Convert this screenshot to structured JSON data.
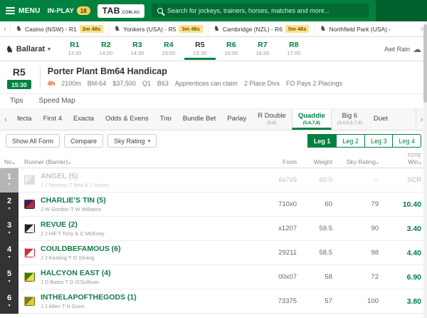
{
  "header": {
    "menu": "MENU",
    "in_play": "IN-PLAY",
    "in_play_count": "18",
    "logo_main": "TAB",
    "logo_suffix": ".COM.AU",
    "search_placeholder": "Search for jockeys, trainers, horses, matches and more...",
    "colors": {
      "bar_green": "#00813f",
      "search_green": "#006a33",
      "badge_yellow": "#ffe18a"
    }
  },
  "next_to_go": {
    "items": [
      {
        "name": "Casino (NSW) - R1",
        "countdown": "2m 48s"
      },
      {
        "name": "Yonkers (USA) - R5",
        "countdown": "3m 48s"
      },
      {
        "name": "Cambridge (NZL) - R6",
        "countdown": "5m 48s"
      },
      {
        "name": "Northfield Park (USA) -",
        "countdown": ""
      }
    ]
  },
  "race_nav": {
    "venue": "Ballarat",
    "weather": "Awt Rain",
    "races": [
      {
        "no": "R1",
        "time": "13:30",
        "selected": false
      },
      {
        "no": "R2",
        "time": "14:00",
        "selected": false
      },
      {
        "no": "R3",
        "time": "14:30",
        "selected": false
      },
      {
        "no": "R4",
        "time": "15:00",
        "selected": false
      },
      {
        "no": "R5",
        "time": "15:30",
        "selected": true
      },
      {
        "no": "R6",
        "time": "16:00",
        "selected": false
      },
      {
        "no": "R7",
        "time": "16:30",
        "selected": false
      },
      {
        "no": "R8",
        "time": "17:00",
        "selected": false
      }
    ]
  },
  "race_header": {
    "race_no": "R5",
    "time": "15:30",
    "title": "Porter Plant Bm64 Handicap",
    "countdown": "4h",
    "meta_items": [
      "2100m",
      "BM-64",
      "$37,500",
      "Q1",
      "B63",
      "Apprentices can claim",
      "2 Place Divs",
      "FO Pays 2 Placings"
    ]
  },
  "view_tabs": [
    {
      "label": "Tips"
    },
    {
      "label": "Speed Map"
    }
  ],
  "bet_tabs": [
    {
      "label": "fecta",
      "sub": "",
      "selected": false
    },
    {
      "label": "First 4",
      "sub": "",
      "selected": false
    },
    {
      "label": "Exacta",
      "sub": "",
      "selected": false
    },
    {
      "label": "Odds & Evens",
      "sub": "",
      "selected": false
    },
    {
      "label": "Trio",
      "sub": "",
      "selected": false
    },
    {
      "label": "Bundle Bet",
      "sub": "",
      "selected": false
    },
    {
      "label": "Parlay",
      "sub": "",
      "selected": false
    },
    {
      "label": "R Double",
      "sub": "(5,6)",
      "selected": false
    },
    {
      "label": "Quaddie",
      "sub": "(5,6,7,8)",
      "selected": true
    },
    {
      "label": "Big 6",
      "sub": "(3,4,5,6,7,8)",
      "selected": false
    },
    {
      "label": "Duet",
      "sub": "",
      "selected": false
    }
  ],
  "controls": {
    "show_all_form": "Show All Form",
    "compare": "Compare",
    "sky_rating": "Sky Rating",
    "legs": [
      {
        "label": "Leg 1",
        "selected": true
      },
      {
        "label": "Leg 2",
        "selected": false
      },
      {
        "label": "Leg 3",
        "selected": false
      },
      {
        "label": "Leg 4",
        "selected": false
      }
    ]
  },
  "table": {
    "headers": {
      "no": "No",
      "runner": "Runner (Barrier)",
      "form": "Form",
      "weight": "Weight",
      "sky_rating": "Sky Rating",
      "tote": "TOTE",
      "win": "Win"
    },
    "rows": [
      {
        "no": "1",
        "name": "ANGEL (5)",
        "connections": "J J Noonan   T Ben & J Hayes",
        "form": "6x7x9",
        "weight": "60.5",
        "sky_rating": "--",
        "win": "SCR",
        "scratched": true,
        "silk1": "#cfcfcf",
        "silk2": "#9e9e9e"
      },
      {
        "no": "2",
        "name": "CHARLIE'S TIN (5)",
        "connections": "J W Gordon   T W Williams",
        "form": "710x0",
        "weight": "60",
        "sky_rating": "79",
        "win": "10.40",
        "scratched": false,
        "silk1": "#1b2a6b",
        "silk2": "#c62828"
      },
      {
        "no": "3",
        "name": "REVUE (2)",
        "connections": "J J Hill   T Tony & C McEvoy",
        "form": "x1207",
        "weight": "59.5",
        "sky_rating": "90",
        "win": "3.40",
        "scratched": false,
        "silk1": "#212121",
        "silk2": "#eeeeee"
      },
      {
        "no": "4",
        "name": "COULDBEFAMOUS (6)",
        "connections": "J J Keating   T G Strang",
        "form": "29211",
        "weight": "58.5",
        "sky_rating": "98",
        "win": "4.40",
        "scratched": false,
        "silk1": "#d32f2f",
        "silk2": "#ffffff"
      },
      {
        "no": "5",
        "name": "HALCYON EAST (4)",
        "connections": "J D Bates   T D O'Sullivan",
        "form": "00x07",
        "weight": "58",
        "sky_rating": "72",
        "win": "6.90",
        "scratched": false,
        "silk1": "#2e7d32",
        "silk2": "#fdd835"
      },
      {
        "no": "6",
        "name": "INTHELAPOFTHEGODS (1)",
        "connections": "J J Allen   T N Dunn",
        "form": "73375",
        "weight": "57",
        "sky_rating": "100",
        "win": "3.80",
        "scratched": false,
        "silk1": "#558b2f",
        "silk2": "#fbc02d"
      }
    ]
  },
  "icons": {
    "horse": "♞",
    "cloud": "☁",
    "chevron_left": "‹",
    "chevron_right": "›",
    "caret_down": "▾",
    "expand": "▾",
    "sort": "▴"
  }
}
